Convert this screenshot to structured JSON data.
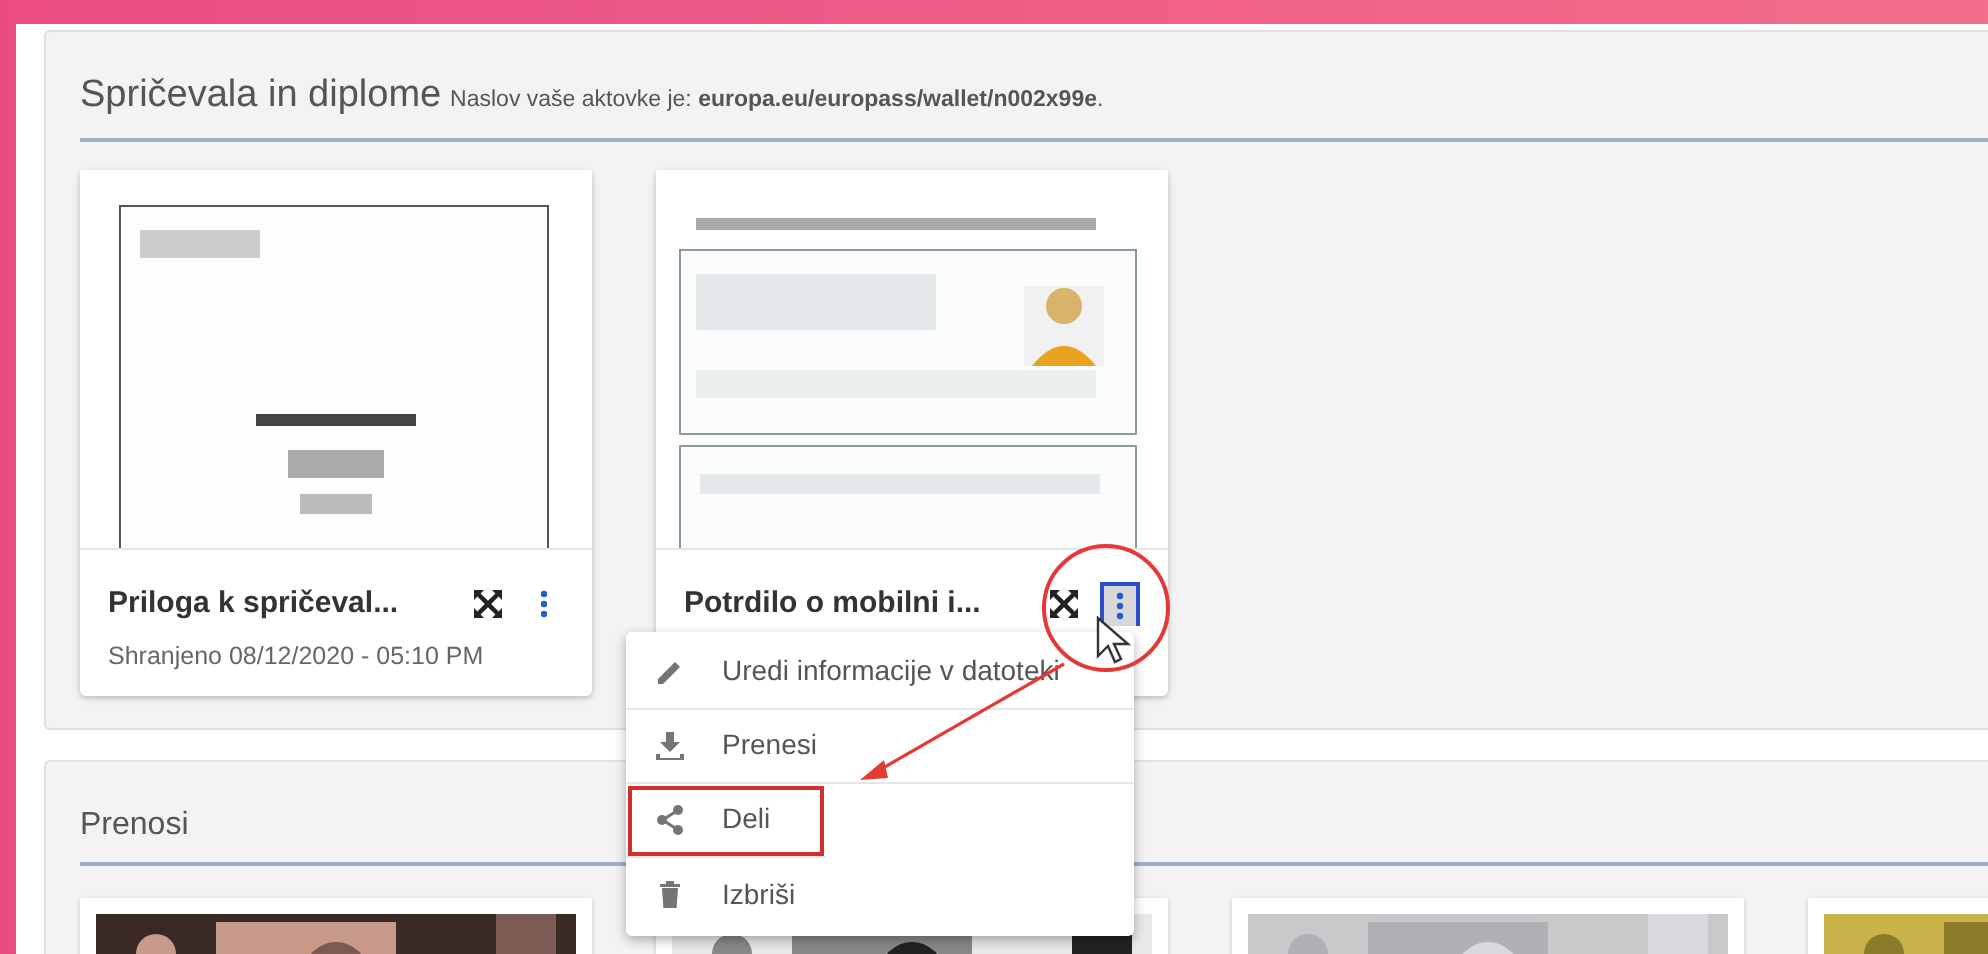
{
  "wallet": {
    "title": "Spričevala in diplome",
    "subtitle": "Naslov vaše aktovke je: **europa.eu/europass/wallet/n002x99e**.",
    "documents": [
      {
        "kind": "picture",
        "title": "Priloga k spričeval...",
        "saved": "Shranjeno 08/12/2020 - 05:10 PM",
        "menu_open": false,
        "circled": false
      },
      {
        "kind": "picture",
        "title": "Potrdilo o mobilni i...",
        "menu_open": true,
        "circled": true
      }
    ]
  },
  "menu": {
    "items": [
      {
        "kind": "edit",
        "label": "Uredi informacije v datoteki",
        "highlighted": false
      },
      {
        "kind": "download",
        "label": "Prenesi",
        "highlighted": false
      },
      {
        "kind": "share",
        "label": "Deli",
        "highlighted": true
      },
      {
        "kind": "delete",
        "label": "Izbriši",
        "highlighted": false
      }
    ]
  },
  "uploads": {
    "title": "Prenosi"
  }
}
